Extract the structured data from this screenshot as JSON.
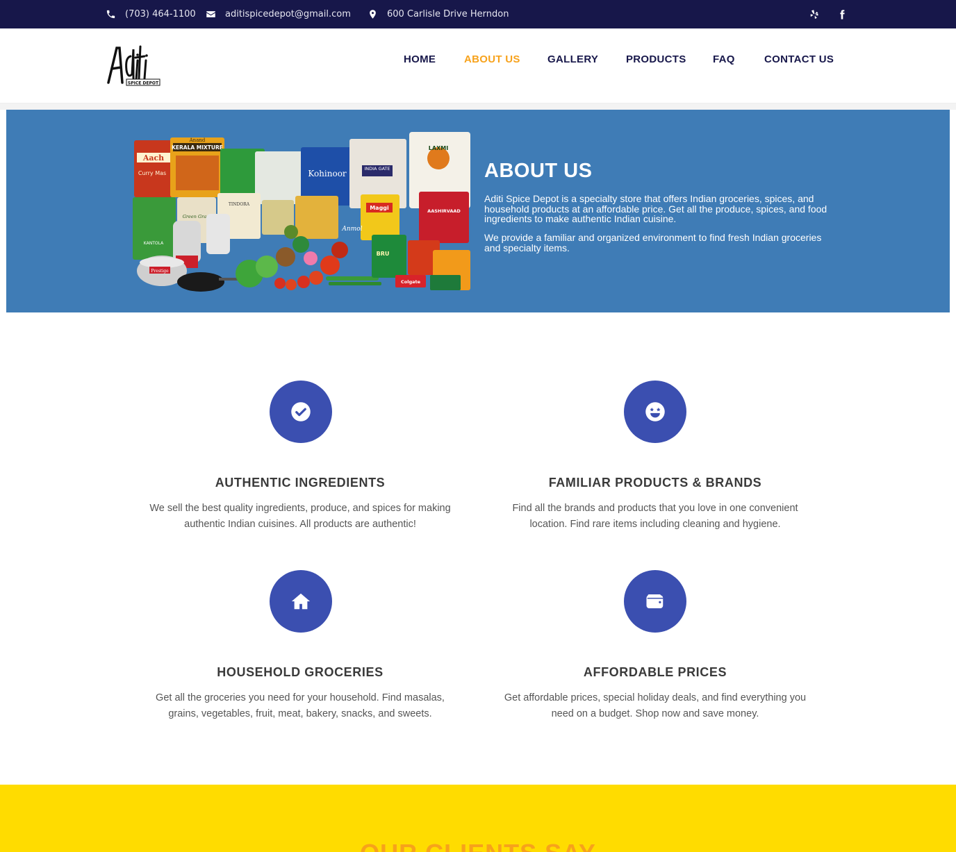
{
  "topbar": {
    "phone": "(703) 464-1100",
    "email": "aditispicedepot@gmail.com",
    "address": "600 Carlisle Drive Herndon",
    "icons": [
      "phone-icon",
      "envelope-icon",
      "map-marker-icon",
      "yelp-icon",
      "facebook-icon"
    ]
  },
  "brand": {
    "logo_text": "Aditi",
    "logo_subtext": "SPICE DEPOT"
  },
  "nav": {
    "items": [
      {
        "label": "HOME"
      },
      {
        "label": "ABOUT US",
        "active": true
      },
      {
        "label": "GALLERY"
      },
      {
        "label": "PRODUCTS"
      },
      {
        "label": "FAQ"
      },
      {
        "label": "CONTACT US"
      }
    ]
  },
  "hero": {
    "title": "ABOUT US",
    "paragraph1": "Aditi Spice Depot is a specialty store that offers Indian groceries, spices, and household products at an affordable price. Get all the produce, spices, and food ingredients to make authentic Indian cuisine.",
    "paragraph2": "We provide a familiar and organized environment to find fresh Indian groceries and specialty items.",
    "image_labels": [
      "Aach",
      "Curry Mas",
      "KERALA MIXTURE",
      "Anand",
      "Kohinoor",
      "INDIA GATE",
      "LAXMI",
      "Maggi",
      "AASHIRVAAD",
      "BRU",
      "Prestige",
      "Green Gram",
      "KANTOLA",
      "TINDORA",
      "Anmol",
      "Colgate"
    ]
  },
  "features": [
    {
      "icon": "check-circle-icon",
      "title": "AUTHENTIC INGREDIENTS",
      "line1": "We sell the best quality ingredients, produce, and spices for making",
      "line2": "authentic Indian cuisines. All products are authentic!"
    },
    {
      "icon": "grin-stars-icon",
      "title": "FAMILIAR PRODUCTS & BRANDS",
      "line1": "Find all the brands and products that you love in one convenient",
      "line2": "location. Find rare items including cleaning and hygiene."
    },
    {
      "icon": "home-icon",
      "title": "HOUSEHOLD GROCERIES",
      "line1": "Get all the groceries you need for your household. Find masalas,",
      "line2": "grains, vegetables, fruit, meat, bakery, snacks, and sweets."
    },
    {
      "icon": "wallet-icon",
      "title": "AFFORDABLE PRICES",
      "line1": "Get affordable prices, special holiday deals, and find everything you",
      "line2": "need on a budget. Shop now and save money."
    }
  ],
  "testimonials": {
    "title": "OUR CLIENTS SAY"
  },
  "colors": {
    "topbar": "#17174a",
    "accent": "#f7a21b",
    "hero_bg": "#3f7cb6",
    "icon_circle": "#3b4fb0",
    "yellow": "#ffdc00"
  }
}
